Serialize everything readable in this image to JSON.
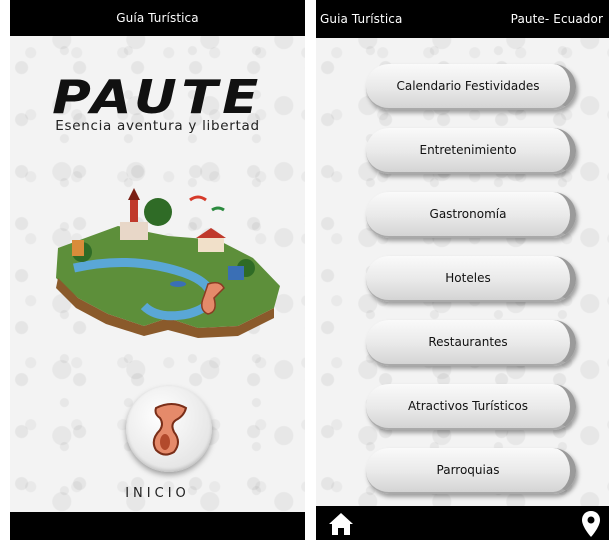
{
  "left_screen": {
    "header_title": "Guía Turística",
    "logo_text": "PAUTE",
    "tagline": "Esencia aventura y libertad",
    "start_label": "INICIO"
  },
  "right_screen": {
    "header_title": "Guia Turística",
    "header_location": "Paute- Ecuador",
    "menu": [
      {
        "label": "Calendario Festividades"
      },
      {
        "label": "Entretenimiento"
      },
      {
        "label": "Gastronomía"
      },
      {
        "label": "Hoteles"
      },
      {
        "label": "Restaurantes"
      },
      {
        "label": "Atractivos Turísticos"
      },
      {
        "label": "Parroquias"
      }
    ],
    "nav_icons": [
      "home-icon",
      "location-pin-icon"
    ]
  },
  "colors": {
    "bar": "#000000",
    "background": "#f3f3f3",
    "accent_pottery": "#e58a6a"
  }
}
